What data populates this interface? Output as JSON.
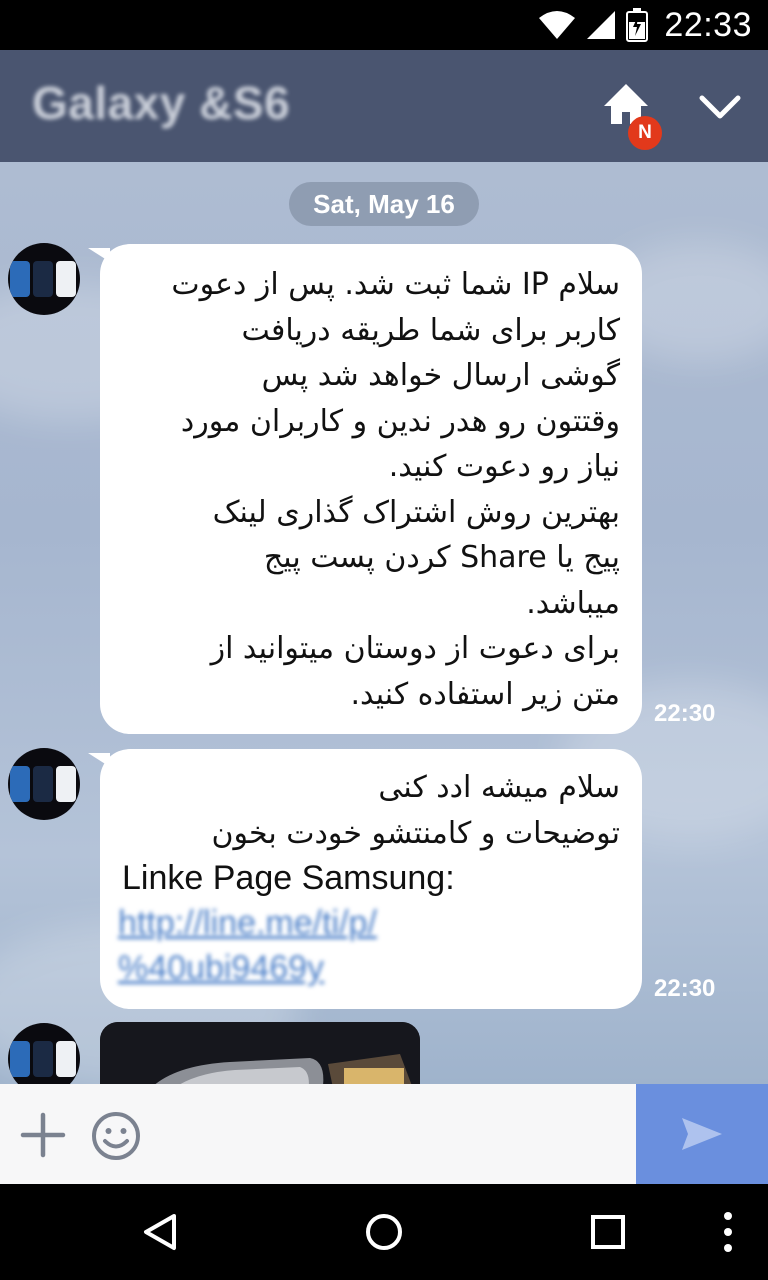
{
  "status_bar": {
    "time": "22:33",
    "icons": [
      "wifi-icon",
      "cell-signal-icon",
      "battery-charging-icon"
    ]
  },
  "header": {
    "title": "Galaxy &S6",
    "home_icon": "home-icon",
    "badge": "N",
    "collapse_icon": "chevron-down-icon",
    "background": "#4a5570"
  },
  "chat": {
    "date": "Sat, May 16",
    "messages": [
      {
        "lines": [
          "سلام IP شما ثبت شد. پس از دعوت",
          "کاربر برای شما طریقه دریافت",
          "گوشی ارسال خواهد شد پس",
          "وقتتون رو هدر ندین و کاربران مورد",
          "نیاز رو دعوت کنید.",
          "بهترین روش اشتراک گذاری لینک",
          "پیج یا Share کردن پست پیج",
          "میباشد.",
          "برای دعوت از دوستان میتوانید از",
          "متن زیر استفاده کنید."
        ],
        "time": "22:30"
      },
      {
        "lines": [
          "سلام میشه ادد کنی",
          "توضیحات و کامنتشو خودت بخون"
        ],
        "text_ltr": "Linke Page Samsung:",
        "link_lines": [
          "http://line.me/ti/p/",
          "%40ubi9469y"
        ],
        "time": "22:30"
      }
    ]
  },
  "input": {
    "placeholder": "",
    "plus_icon": "plus-icon",
    "emoji_icon": "emoji-icon",
    "send_icon": "send-icon",
    "send_color": "#6a8fde"
  },
  "nav_bar": {
    "icons": [
      "back-icon",
      "home-circle-icon",
      "recents-icon",
      "more-icon"
    ]
  }
}
